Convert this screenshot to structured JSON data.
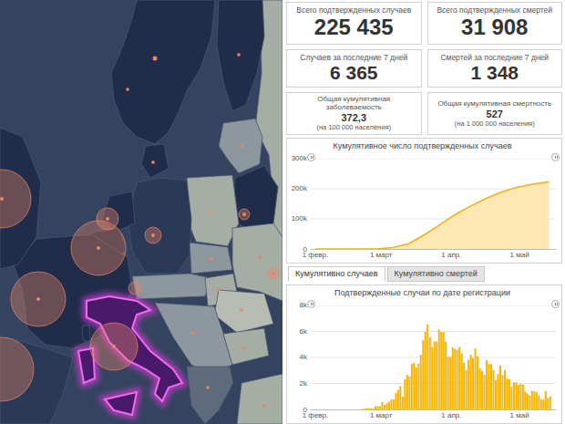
{
  "stat_rows": [
    [
      {
        "label": "Всего подтвержденных случаев",
        "value": "225 435"
      },
      {
        "label": "Всего подтвержденных смертей",
        "value": "31 908"
      }
    ],
    [
      {
        "label": "Случаев за последние 7 дней",
        "value": "6 365"
      },
      {
        "label": "Смертей за последние 7 дней",
        "value": "1 348"
      }
    ],
    [
      {
        "label": "Общая кумулятивная заболеваемость",
        "value": "372,3",
        "note": "(на 100 000 населения)"
      },
      {
        "label": "Общая кумулятивная смертность",
        "value": "527",
        "note": "(на 1 000 000 населения)"
      }
    ]
  ],
  "cumulative_chart": {
    "title": "Кумулятивное число подтвержденных случаев",
    "y_ticks": [
      {
        "label": "300k",
        "value": 300000
      },
      {
        "label": "200k",
        "value": 200000
      },
      {
        "label": "100k",
        "value": 100000
      },
      {
        "label": "0",
        "value": 0
      }
    ],
    "x_ticks": [
      {
        "label": "1 февр.",
        "day": 0
      },
      {
        "label": "1 март",
        "day": 29
      },
      {
        "label": "1 апр.",
        "day": 60
      },
      {
        "label": "1 май",
        "day": 90
      }
    ],
    "x_domain": [
      -2,
      106
    ],
    "series": [
      {
        "start_day": 0,
        "end_day": 103,
        "values": [
          0,
          2,
          3,
          20,
          900,
          4600,
          17700,
          47000,
          80500,
          115200,
          143600,
          168900,
          189900,
          205500,
          215900,
          223096
        ]
      }
    ]
  },
  "tabs": [
    {
      "label": "Кумулятивно случаев",
      "selected": true
    },
    {
      "label": "Кумулятивно смертей",
      "selected": false
    }
  ],
  "daily_chart": {
    "title": "Подтвержденные случаи по дате регистрации",
    "y_ticks": [
      {
        "label": "8k",
        "value": 8000
      },
      {
        "label": "6k",
        "value": 6000
      },
      {
        "label": "4k",
        "value": 4000
      },
      {
        "label": "2k",
        "value": 2000
      },
      {
        "label": "0",
        "value": 0
      }
    ],
    "x_ticks": [
      {
        "label": "1 февр.",
        "day": 0
      },
      {
        "label": "1 март",
        "day": 29
      },
      {
        "label": "1 апр.",
        "day": 60
      },
      {
        "label": "1 май",
        "day": 90
      }
    ],
    "x_domain": [
      -2,
      106
    ],
    "series": [
      {
        "start_day": 0,
        "values": [
          0,
          0,
          0,
          0,
          0,
          0,
          2,
          0,
          0,
          0,
          0,
          0,
          0,
          0,
          0,
          0,
          0,
          0,
          0,
          0,
          17,
          60,
          73,
          105,
          93,
          78,
          250,
          238,
          240,
          566,
          342,
          466,
          587,
          769,
          778,
          1247,
          1492,
          1797,
          977,
          2313,
          2651,
          2547,
          3497,
          3590,
          3233,
          3526,
          4207,
          5322,
          5986,
          6557,
          5560,
          4789,
          5249,
          5210,
          6153,
          5959,
          5974,
          5217,
          4050,
          4053,
          4782,
          4668,
          4585,
          4805,
          4316,
          3599,
          3039,
          3836,
          4204,
          3951,
          4694,
          4092,
          3153,
          2972,
          2667,
          3786,
          3493,
          3491,
          3047,
          2256,
          2729,
          3370,
          2646,
          3021,
          2357,
          2324,
          1739,
          2091,
          2086,
          1872,
          1965,
          1900,
          1389,
          1221,
          1075,
          1444,
          1401,
          1327,
          1083,
          802,
          744,
          1402,
          888,
          992
        ]
      }
    ]
  }
}
